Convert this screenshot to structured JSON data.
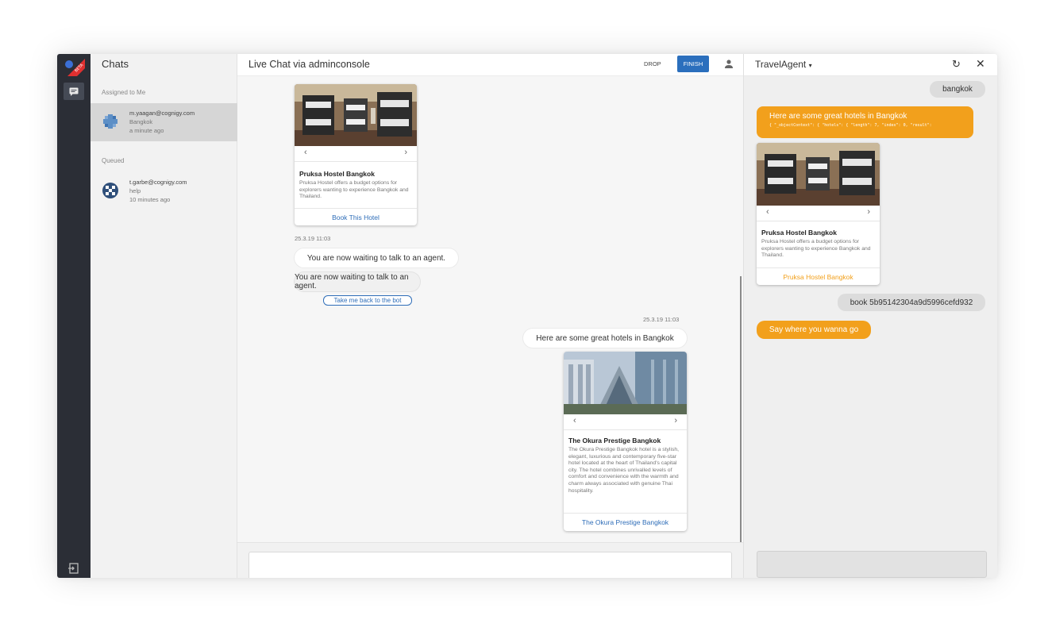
{
  "sidebar": {
    "badge": "BETA",
    "chats_title": "Chats",
    "assigned_label": "Assigned to Me",
    "queued_label": "Queued",
    "assigned": [
      {
        "email": "m.yaagan@cognigy.com",
        "line2": "Bangkok",
        "time": "a minute ago"
      }
    ],
    "queued": [
      {
        "email": "t.garbe@cognigy.com",
        "line2": "help",
        "time": "10 minutes ago"
      }
    ]
  },
  "header": {
    "title": "Live Chat via adminconsole",
    "drop_label": "DROP",
    "finish_label": "FINISH"
  },
  "conversation": {
    "card1": {
      "title": "Pruksa Hostel Bangkok",
      "description": "Pruksa Hostel offers a budget options for explorers wanting to experience Bangkok and Thailand.",
      "button": "Book This Hotel"
    },
    "timestamp1": "25.3.19 11:03",
    "msg_waiting_1": "You are now waiting to talk to an agent.",
    "msg_waiting_2": "You are now waiting to talk to an agent.",
    "back_button": "Take me back to the bot",
    "timestamp2": "25.3.19 11:03",
    "msg_hotels": "Here are some great hotels in Bangkok",
    "card2": {
      "title": "The Okura Prestige Bangkok",
      "description": "The Okura Prestige Bangkok hotel is a stylish, elegant, luxurious and contemporary five-star hotel located at the heart of Thailand's capital city. The hotel combines unrivalled levels of comfort and convenience with the warmth and charm always associated with genuine Thai hospitality.",
      "button": "The Okura Prestige Bangkok"
    }
  },
  "agent_panel": {
    "title": "TravelAgent",
    "msg_user_1": "bangkok",
    "msg_bot_1": "Here are some great hotels in Bangkok",
    "json_preview": "{ \"_objectContext\": { \"hotels\": { \"length\": 7, \"index\": 0, \"result\":",
    "card": {
      "title": "Pruksa Hostel Bangkok",
      "description": "Pruksa Hostel offers a budget options for explorers wanting to experience Bangkok and Thailand.",
      "button": "Pruksa Hostel Bangkok"
    },
    "msg_user_2": "book 5b95142304a9d5996cefd932",
    "msg_bot_2": "Say where you wanna go"
  },
  "colors": {
    "rail": "#2b2e36",
    "finish": "#2b6fbd",
    "bot_bubble": "#f2a01c",
    "link": "#2e6db8"
  }
}
